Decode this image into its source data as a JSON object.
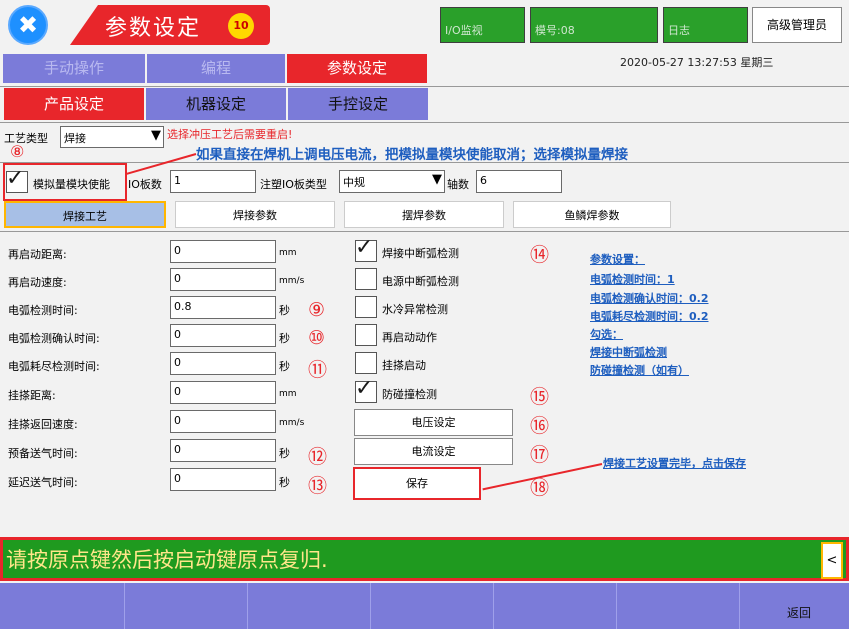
{
  "header": {
    "title": "参数设定",
    "badge": "10",
    "io_monitor": "I/O监视",
    "module_no": "模号:08",
    "log": "日志",
    "admin": "高级管理员"
  },
  "main_tabs": [
    {
      "label": "手动操作"
    },
    {
      "label": "编程"
    },
    {
      "label": "参数设定"
    }
  ],
  "datetime": "2020-05-27  13:27:53  星期三",
  "sub_tabs": [
    {
      "label": "产品设定"
    },
    {
      "label": "机器设定"
    },
    {
      "label": "手控设定"
    }
  ],
  "process": {
    "label": "工艺类型",
    "value": "焊接",
    "warning": "选择冲压工艺后需要重启!"
  },
  "annotations": {
    "n8": "⑧",
    "tip_top": "如果直接在焊机上调电压电流，把模拟量模块使能取消；选择模拟量焊接",
    "n9": "⑨",
    "n10": "⑩",
    "n11": "⑪",
    "n12": "⑫",
    "n13": "⑬",
    "n14": "⑭",
    "n15": "⑮",
    "n16": "⑯",
    "n17": "⑰",
    "n18": "⑱",
    "tip_save": "焊接工艺设置完毕，点击保存"
  },
  "analog": {
    "enable_label": "模拟量模块使能",
    "io_count_label": "IO板数",
    "io_count_value": "1",
    "io_type_label": "注塑IO板类型",
    "io_type_value": "中规",
    "axis_label": "轴数",
    "axis_value": "6"
  },
  "panel_tabs": [
    {
      "label": "焊接工艺"
    },
    {
      "label": "焊接参数"
    },
    {
      "label": "摆焊参数"
    },
    {
      "label": "鱼鳞焊参数"
    }
  ],
  "params": [
    {
      "label": "再启动距离:",
      "value": "0",
      "unit": "mm"
    },
    {
      "label": "再启动速度:",
      "value": "0",
      "unit": "mm/s"
    },
    {
      "label": "电弧检测时间:",
      "value": "0.8",
      "unit": "秒"
    },
    {
      "label": "电弧检测确认时间:",
      "value": "0",
      "unit": "秒"
    },
    {
      "label": "电弧耗尽检测时间:",
      "value": "0",
      "unit": "秒"
    },
    {
      "label": "挂搽距离:",
      "value": "0",
      "unit": "mm"
    },
    {
      "label": "挂搽返回速度:",
      "value": "0",
      "unit": "mm/s"
    },
    {
      "label": "预备送气时间:",
      "value": "0",
      "unit": "秒"
    },
    {
      "label": "延迟送气时间:",
      "value": "0",
      "unit": "秒"
    }
  ],
  "checks": [
    {
      "label": "焊接中断弧检测",
      "checked": true
    },
    {
      "label": "电源中断弧检测",
      "checked": false
    },
    {
      "label": "水冷异常检测",
      "checked": false
    },
    {
      "label": "再启动动作",
      "checked": false
    },
    {
      "label": "挂搽启动",
      "checked": false
    },
    {
      "label": "防碰撞检测",
      "checked": true
    }
  ],
  "buttons": {
    "voltage": "电压设定",
    "current": "电流设定",
    "save": "保存"
  },
  "notes": [
    "参数设置：",
    "电弧检测时间：1",
    "电弧检测确认时间：0.2",
    "电弧耗尽检测时间：0.2",
    "勾选：",
    "焊接中断弧检测",
    "防碰撞检测（如有）"
  ],
  "status": "请按原点键然后按启动键原点复归.",
  "scroll_icon": "<",
  "back": "返回",
  "colors": {
    "accent_red": "#e8262b",
    "tab_purple": "#7b7bd9",
    "green": "#2aa02a",
    "link_blue": "#1e5ebf"
  }
}
